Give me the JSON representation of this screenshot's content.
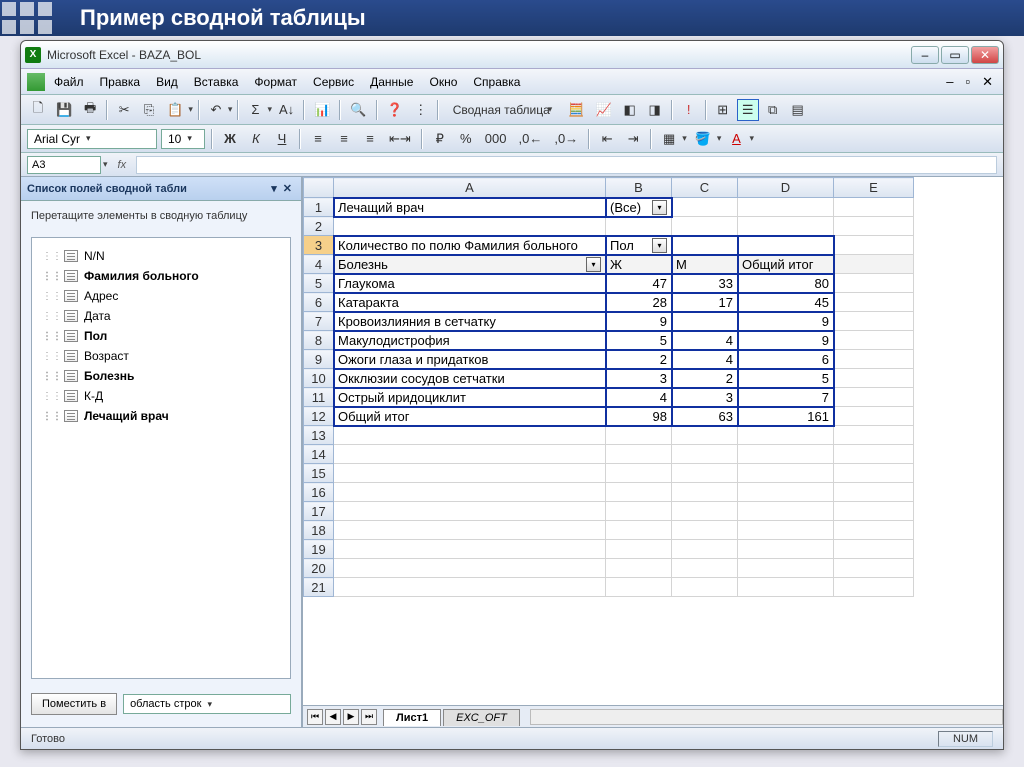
{
  "slide_title": "Пример сводной таблицы",
  "window": {
    "title": "Microsoft Excel - BAZA_BOL",
    "xlicon": "X"
  },
  "menubar": {
    "items": [
      "Файл",
      "Правка",
      "Вид",
      "Вставка",
      "Формат",
      "Сервис",
      "Данные",
      "Окно",
      "Справка"
    ]
  },
  "toolbar": {
    "pivot_label": "Сводная таблица"
  },
  "format": {
    "font": "Arial Cyr",
    "size": "10"
  },
  "fmla": {
    "name": "A3",
    "fx": "fx"
  },
  "taskpane": {
    "title": "Список полей сводной табли",
    "hint": "Перетащите элементы в сводную таблицу",
    "fields": [
      {
        "label": "N/N",
        "bold": false
      },
      {
        "label": "Фамилия больного",
        "bold": true
      },
      {
        "label": "Адрес",
        "bold": false
      },
      {
        "label": "Дата",
        "bold": false
      },
      {
        "label": "Пол",
        "bold": true
      },
      {
        "label": "Возраст",
        "bold": false
      },
      {
        "label": "Болезнь",
        "bold": true
      },
      {
        "label": "К-Д",
        "bold": false
      },
      {
        "label": "Лечащий врач",
        "bold": true
      }
    ],
    "place_btn": "Поместить в",
    "area": "область строк"
  },
  "grid": {
    "cols": [
      "A",
      "B",
      "C",
      "D",
      "E"
    ],
    "page_field": "Лечащий врач",
    "page_value": "(Все)",
    "data_label": "Количество по полю Фамилия больного",
    "col_field": "Пол",
    "row_field": "Болезнь",
    "col_hdrs": [
      "Ж",
      "М",
      "Общий итог"
    ],
    "rows": [
      {
        "n": "5",
        "a": "Глаукома",
        "b": "47",
        "c": "33",
        "d": "80"
      },
      {
        "n": "6",
        "a": "Катаракта",
        "b": "28",
        "c": "17",
        "d": "45"
      },
      {
        "n": "7",
        "a": "Кровоизлияния в сетчатку",
        "b": "9",
        "c": "",
        "d": "9"
      },
      {
        "n": "8",
        "a": "Макулодистрофия",
        "b": "5",
        "c": "4",
        "d": "9"
      },
      {
        "n": "9",
        "a": "Ожоги глаза и придатков",
        "b": "2",
        "c": "4",
        "d": "6"
      },
      {
        "n": "10",
        "a": "Окклюзии сосудов сетчатки",
        "b": "3",
        "c": "2",
        "d": "5"
      },
      {
        "n": "11",
        "a": "Острый иридоциклит",
        "b": "4",
        "c": "3",
        "d": "7"
      },
      {
        "n": "12",
        "a": "Общий итог",
        "b": "98",
        "c": "63",
        "d": "161"
      }
    ],
    "empty_rows": [
      "13",
      "14",
      "15",
      "16",
      "17",
      "18",
      "19",
      "20",
      "21"
    ]
  },
  "sheets": {
    "active": "Лист1",
    "other": "EXC_OFT"
  },
  "status": {
    "ready": "Готово",
    "num": "NUM"
  }
}
